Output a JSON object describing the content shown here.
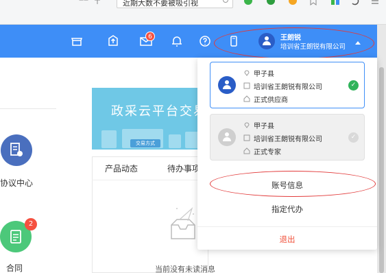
{
  "browser": {
    "search_text": "近期大数不要被吸引视",
    "colors": {
      "bar": "#f5f6f7"
    }
  },
  "header": {
    "message_badge": "6",
    "user": {
      "name": "王朗锐",
      "org": "培训省王朗锐有限公司"
    },
    "icons": [
      "store-icon",
      "upload-icon",
      "mail-icon",
      "bell-icon",
      "help-icon",
      "phone-icon"
    ],
    "colors": {
      "background": "#3e8ef7",
      "badge": "#f5503f"
    }
  },
  "sidebar": {
    "items": [
      {
        "label": "协议中心",
        "icon": "meeting-center-icon",
        "color": "#4a6fbe"
      },
      {
        "label": "合同",
        "icon": "contract-icon",
        "badge": "2",
        "color": "#4cc87a"
      }
    ]
  },
  "main": {
    "banner": {
      "title": "政采云平台交易",
      "button": "交易方式"
    },
    "tabs": [
      {
        "label": "产品动态"
      },
      {
        "label": "待办事项"
      }
    ],
    "empty_message": "当前没有未读消息"
  },
  "dropdown": {
    "accounts": [
      {
        "region": "甲子县",
        "org": "培训省王朗锐有限公司",
        "role": "正式供应商",
        "active": true
      },
      {
        "region": "甲子县",
        "org": "培训省王朗锐有限公司",
        "role": "正式专家",
        "active": false
      }
    ],
    "menu": {
      "account_info": "账号信息",
      "delegate": "指定代办",
      "logout": "退出"
    },
    "colors": {
      "active_border": "#3e8ef7",
      "check_active": "#2fb35a",
      "logout": "#f0503a"
    }
  }
}
